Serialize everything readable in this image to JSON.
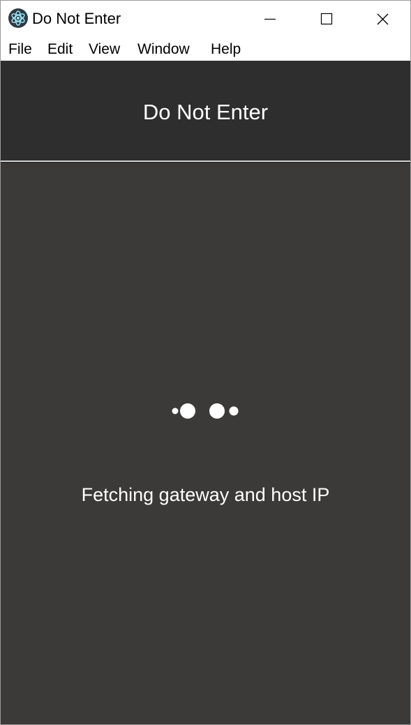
{
  "window": {
    "title": "Do Not Enter",
    "icon": "electron-atom-icon",
    "controls": [
      "minimize-icon",
      "maximize-icon",
      "close-icon"
    ]
  },
  "menu": {
    "items": [
      "File",
      "Edit",
      "View",
      "Window",
      "Help"
    ]
  },
  "header": {
    "title": "Do Not Enter"
  },
  "main": {
    "status": "Fetching gateway and host IP",
    "spinner_icon": "loading-dots-icon"
  },
  "colors": {
    "header_bg": "#2e2e2e",
    "main_bg": "#3b3a38",
    "text": "#ffffff"
  }
}
